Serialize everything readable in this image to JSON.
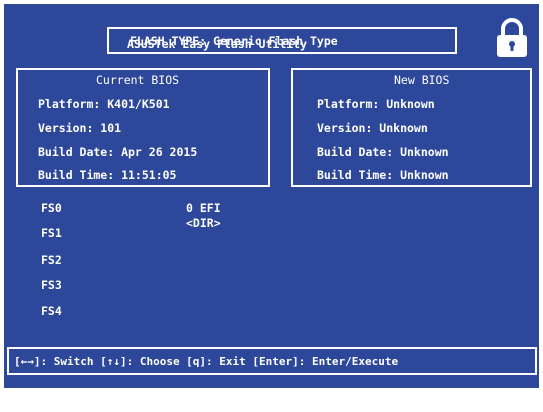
{
  "title": {
    "utility": "ASUSTek Easy Flash Utility",
    "flash_type": "FLASH TYPE: Generic Flash Type"
  },
  "current": {
    "heading": "Current BIOS",
    "platform": "Platform: K401/K501",
    "version": "Version: 101",
    "build_date": "Build Date: Apr 26 2015",
    "build_time": "Build Time: 11:51:05"
  },
  "new": {
    "heading": "New BIOS",
    "platform": "Platform: Unknown",
    "version": "Version: Unknown",
    "build_date": "Build Date: Unknown",
    "build_time": "Build Time: Unknown"
  },
  "file_systems": [
    "FS0",
    "FS1",
    "FS2",
    "FS3",
    "FS4"
  ],
  "directory": [
    "0 EFI",
    "<DIR>"
  ],
  "help": "[←→]: Switch [↑↓]: Choose [q]: Exit [Enter]: Enter/Execute",
  "colors": {
    "background": "#2d479b",
    "text": "#ffffff"
  },
  "icons": [
    "lock-icon"
  ]
}
